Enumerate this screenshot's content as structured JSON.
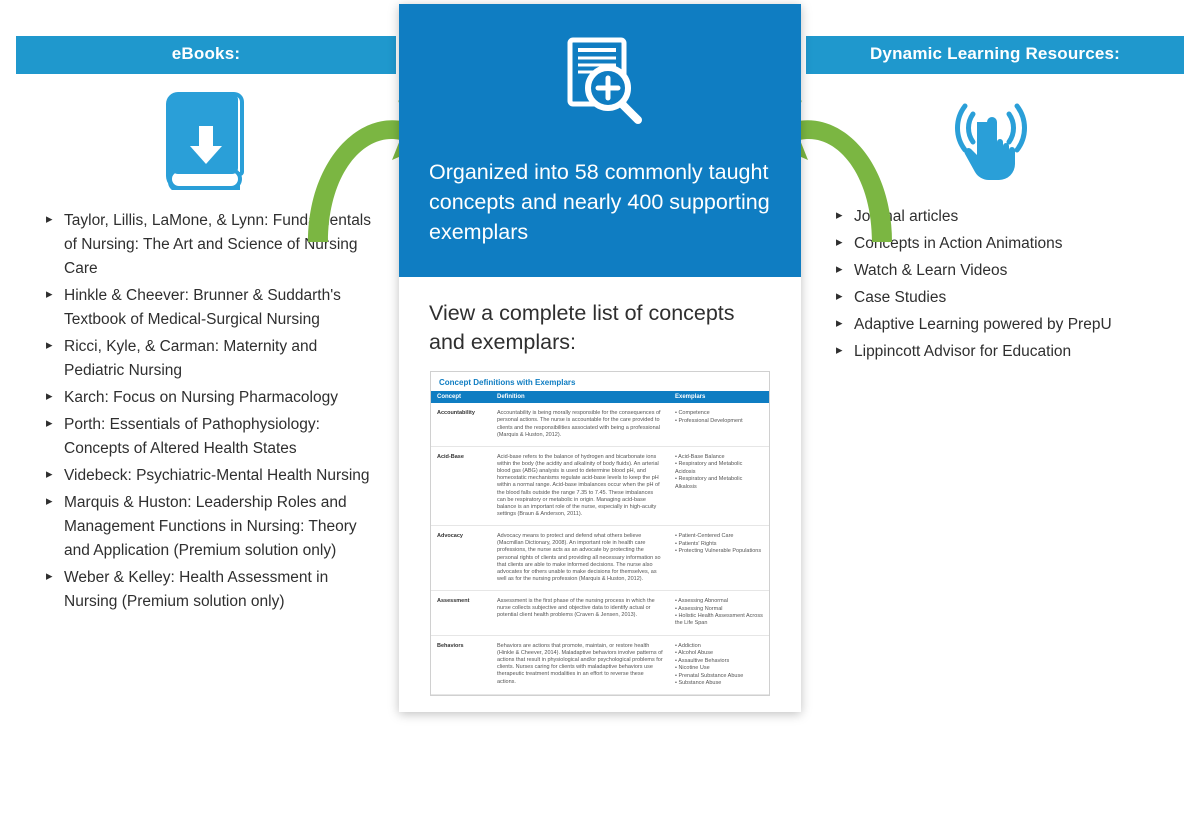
{
  "left": {
    "title": "eBooks:",
    "items": [
      "Taylor, Lillis, LaMone, & Lynn: Fundamentals of Nursing: The Art and Science of Nursing Care",
      "Hinkle & Cheever: Brunner & Suddarth's Textbook of Medical-Surgical Nursing",
      "Ricci, Kyle, & Carman: Maternity and Pediatric Nursing",
      "Karch: Focus on Nursing Pharmacology",
      "Porth: Essentials of Pathophysiology: Concepts of Altered Health States",
      "Videbeck: Psychiatric-Mental Health Nursing",
      "Marquis & Huston: Leadership Roles and Management Functions in Nursing: Theory and Application (Premium solution only)",
      "Weber & Kelley: Health Assessment in Nursing (Premium solution only)"
    ]
  },
  "center": {
    "headline": "Organized into 58 commonly taught concepts and nearly 400 supporting exemplars",
    "subhead": "View a complete list of concepts and exemplars:",
    "sample": {
      "title": "Concept Definitions with Exemplars",
      "cols": {
        "c1": "Concept",
        "c2": "Definition",
        "c3": "Exemplars"
      },
      "rows": [
        {
          "c1": "Accountability",
          "c2": "Accountability is being morally responsible for the consequences of personal actions. The nurse is accountable for the care provided to clients and the responsibilities associated with being a professional (Marquis & Huston, 2012).",
          "c3": "• Competence\n• Professional Development"
        },
        {
          "c1": "Acid-Base",
          "c2": "Acid-base refers to the balance of hydrogen and bicarbonate ions within the body (the acidity and alkalinity of body fluids). An arterial blood gas (ABG) analysis is used to determine blood pH, and homeostatic mechanisms regulate acid-base levels to keep the pH within a normal range. Acid-base imbalances occur when the pH of the blood falls outside the range 7.35 to 7.45. These imbalances can be respiratory or metabolic in origin. Managing acid-base balance is an important role of the nurse, especially in high-acuity settings (Braun & Anderson, 2011).",
          "c3": "• Acid-Base Balance\n• Respiratory and Metabolic Acidosis\n• Respiratory and Metabolic Alkalosis"
        },
        {
          "c1": "Advocacy",
          "c2": "Advocacy means to protect and defend what others believe (Macmillan Dictionary, 2008). An important role in health care professions, the nurse acts as an advocate by protecting the personal rights of clients and providing all necessary information so that clients are able to make informed decisions. The nurse also advocates for others unable to make decisions for themselves, as well as for the nursing profession (Marquis & Huston, 2012).",
          "c3": "• Patient-Centered Care\n• Patients' Rights\n• Protecting Vulnerable Populations"
        },
        {
          "c1": "Assessment",
          "c2": "Assessment is the first phase of the nursing process in which the nurse collects subjective and objective data to identify actual or potential client health problems (Craven & Jensen, 2013).",
          "c3": "• Assessing Abnormal\n• Assessing Normal\n• Holistic Health Assessment Across the Life Span"
        },
        {
          "c1": "Behaviors",
          "c2": "Behaviors are actions that promote, maintain, or restore health (Hinkle & Cheever, 2014). Maladaptive behaviors involve patterns of actions that result in physiological and/or psychological problems for clients. Nurses caring for clients with maladaptive behaviors use therapeutic treatment modalities in an effort to reverse these actions.",
          "c3": "• Addiction\n• Alcohol Abuse\n• Assaultive Behaviors\n• Nicotine Use\n• Prenatal Substance Abuse\n• Substance Abuse"
        }
      ]
    }
  },
  "right": {
    "title": "Dynamic Learning Resources:",
    "items": [
      "Journal articles",
      "Concepts in Action Animations",
      "Watch & Learn Videos",
      "Case Studies",
      "Adaptive Learning powered by PrepU",
      "Lippincott Advisor for Education"
    ]
  }
}
